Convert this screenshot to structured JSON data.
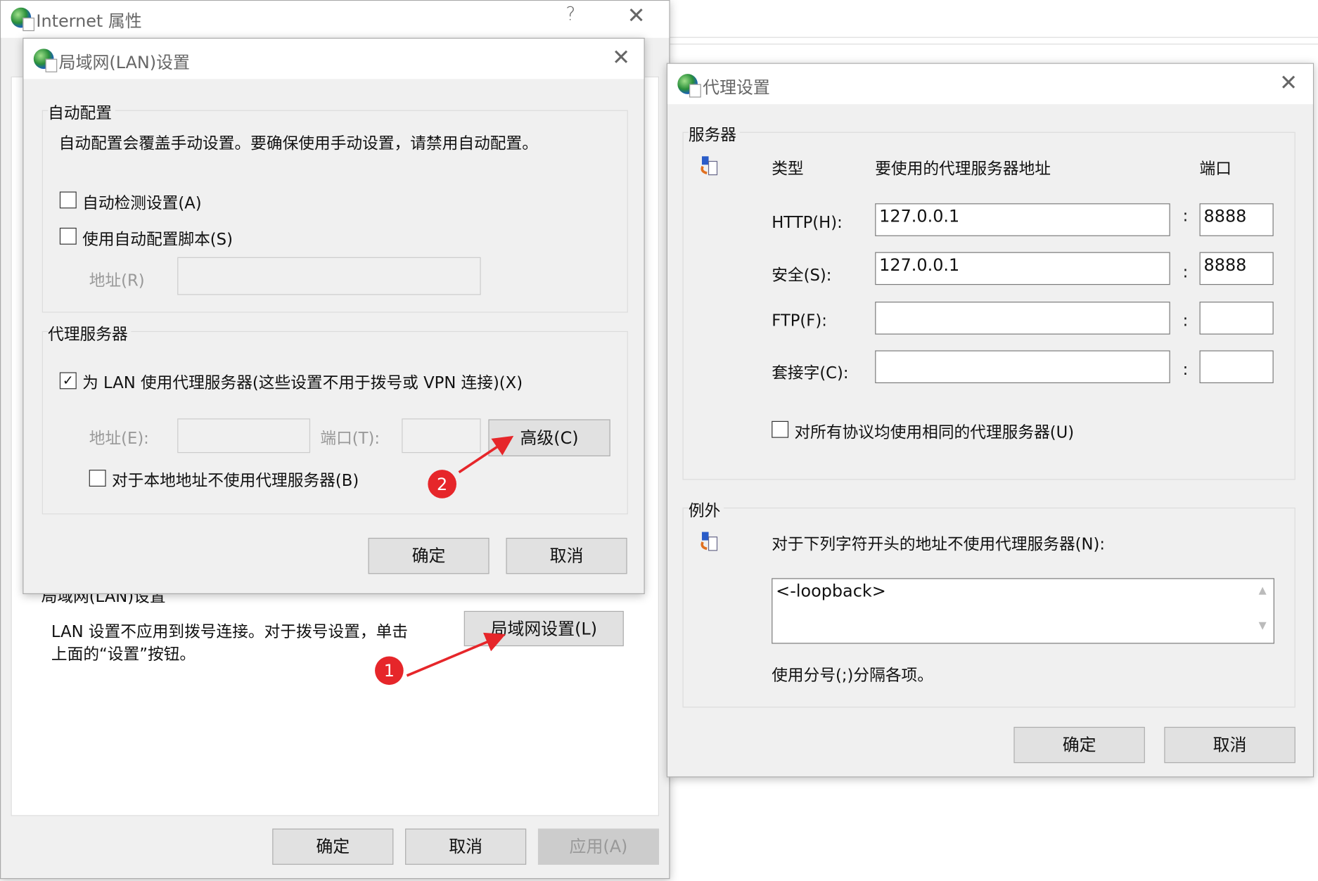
{
  "background_window": {},
  "internet_props": {
    "title": "Internet 属性",
    "help": "?",
    "close": "✕",
    "lan_section_label": "局域网(LAN)设置",
    "lan_desc_1": "LAN 设置不应用到拨号连接。对于拨号设置，单击",
    "lan_desc_2": "上面的“设置”按钮。",
    "lan_button": "局域网设置(L)",
    "ok": "确定",
    "cancel": "取消",
    "apply": "应用(A)"
  },
  "lan": {
    "title": "局域网(LAN)设置",
    "close": "✕",
    "auto_group": "自动配置",
    "auto_desc": "自动配置会覆盖手动设置。要确保使用手动设置，请禁用自动配置。",
    "auto_detect": "自动检测设置(A)",
    "auto_detect_checked": false,
    "auto_script": "使用自动配置脚本(S)",
    "auto_script_checked": false,
    "addr_r": "地址(R)",
    "addr_r_value": "",
    "proxy_group": "代理服务器",
    "use_proxy": "为 LAN 使用代理服务器(这些设置不用于拨号或 VPN 连接)(X)",
    "use_proxy_checked": true,
    "addr_e": "地址(E):",
    "addr_e_value": "",
    "port_t": "端口(T):",
    "port_t_value": "",
    "advanced": "高级(C)",
    "bypass_local": "对于本地地址不使用代理服务器(B)",
    "bypass_local_checked": false,
    "ok": "确定",
    "cancel": "取消"
  },
  "proxy": {
    "title": "代理设置",
    "close": "✕",
    "servers_group": "服务器",
    "col_type": "类型",
    "col_addr": "要使用的代理服务器地址",
    "col_port": "端口",
    "colon": ":",
    "rows": [
      {
        "label": "HTTP(H):",
        "addr": "127.0.0.1",
        "port": "8888"
      },
      {
        "label": "安全(S):",
        "addr": "127.0.0.1",
        "port": "8888"
      },
      {
        "label": "FTP(F):",
        "addr": "",
        "port": ""
      },
      {
        "label": "套接字(C):",
        "addr": "",
        "port": ""
      }
    ],
    "same_proxy": "对所有协议均使用相同的代理服务器(U)",
    "same_proxy_checked": false,
    "exceptions_group": "例外",
    "exceptions_desc": "对于下列字符开头的地址不使用代理服务器(N):",
    "exceptions_value": "<-loopback>",
    "exceptions_hint": "使用分号(;)分隔各项。",
    "ok": "确定",
    "cancel": "取消"
  },
  "annotations": {
    "step1": "1",
    "step2": "2",
    "color": "#e6262a"
  }
}
